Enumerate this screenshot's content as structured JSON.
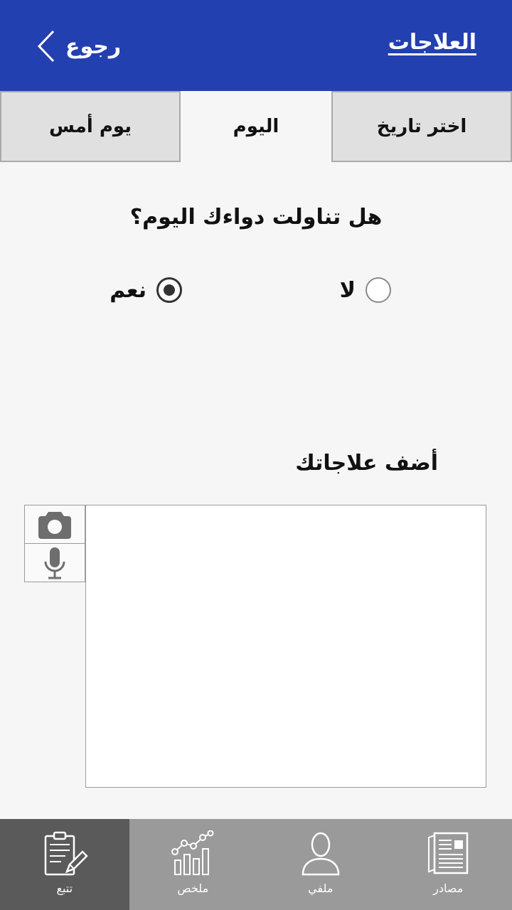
{
  "header": {
    "title": "العلاجات",
    "back_label": "رجوع"
  },
  "tabs": {
    "choose_date": "اختر تاريخ",
    "today": "اليوم",
    "yesterday": "يوم أمس"
  },
  "question": "هل تناولت دواءك اليوم؟",
  "options": {
    "no": "لا",
    "yes": "نعم",
    "selected": "yes"
  },
  "add_label": "أضف علاجاتك",
  "notes": {
    "value": ""
  },
  "nav": [
    {
      "label": "مصادر",
      "icon": "newspaper-icon"
    },
    {
      "label": "ملفي",
      "icon": "person-icon"
    },
    {
      "label": "ملخص",
      "icon": "chart-icon"
    },
    {
      "label": "تتبع",
      "icon": "clipboard-pencil-icon",
      "active": true
    }
  ],
  "colors": {
    "header": "#2340b0",
    "nav": "#9a9a9a",
    "nav_active": "#5a5a5a"
  }
}
